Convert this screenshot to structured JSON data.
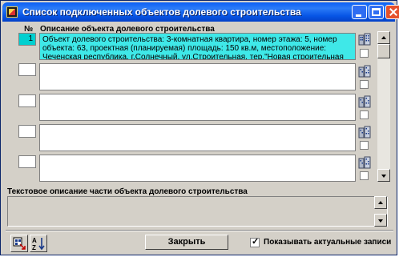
{
  "window": {
    "title": "Список подключенных объектов долевого строительства"
  },
  "table": {
    "col_num_header": "№",
    "col_desc_header": "Описание объекта долевого строительства",
    "rows": [
      {
        "num": "1",
        "desc": "Объект долевого строительства: 3-комнатная квартира, номер этажа: 5, номер объекта: 63, проектная (планируемая) площадь: 150 кв.м, местоположение: Чеченская республика, г.Солнечный, ул.Строительная, тер.\"Новая строительная площадка\", в проекции осей а и с,"
      },
      {
        "num": "",
        "desc": ""
      },
      {
        "num": "",
        "desc": ""
      },
      {
        "num": "",
        "desc": ""
      },
      {
        "num": "",
        "desc": ""
      }
    ]
  },
  "text_description": {
    "label": "Текстовое описание части объекта долевого строительства",
    "value": ""
  },
  "footer": {
    "close_label": "Закрыть",
    "show_actual_label": "Показывать актуальные записи",
    "show_actual_checked": true
  },
  "colors": {
    "titlebar": "#0a5ff6",
    "selected_row": "#3fe8e8",
    "window_bg": "#d4d0c8"
  },
  "icons": [
    "building-icon",
    "sort-icon",
    "select-all-icon"
  ]
}
